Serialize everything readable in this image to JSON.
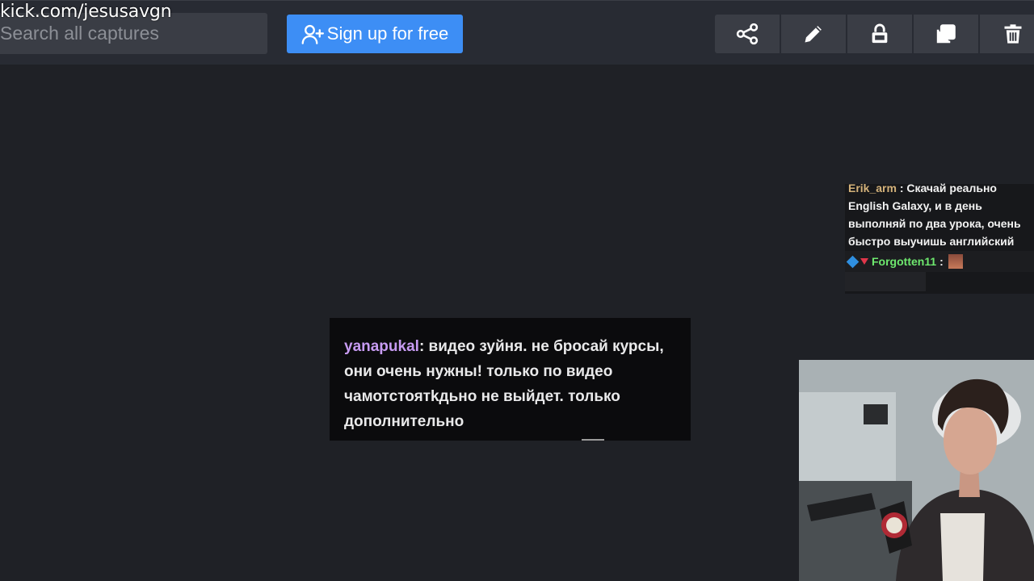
{
  "overlay": {
    "url": "kick.com/jesusavgn"
  },
  "topbar": {
    "search_placeholder": "Search all captures",
    "signup_label": "Sign up for free",
    "tools": [
      {
        "icon": "share-icon"
      },
      {
        "icon": "pencil-icon"
      },
      {
        "icon": "lock-icon"
      },
      {
        "icon": "duplicate-icon"
      },
      {
        "icon": "trash-icon"
      }
    ]
  },
  "chat_popup": {
    "username": "yanapukal",
    "text": ": видео зуйня. не бросай курсы, они очень нужны! только по видео чамотстоятkдьно не выйдет. только дополнительно"
  },
  "side_chat": {
    "msg1_user": "Erik_arm",
    "msg1_text": " : Скачай реально English Galaxy, и в день выполняй по два урока, очень быстро выучишь английский",
    "msg2_user": "Forgotten11",
    "msg2_sep": " :"
  },
  "colors": {
    "accent": "#3d8ef5",
    "popup_username": "#c79bf2",
    "side_username_green": "#6ee86e"
  }
}
